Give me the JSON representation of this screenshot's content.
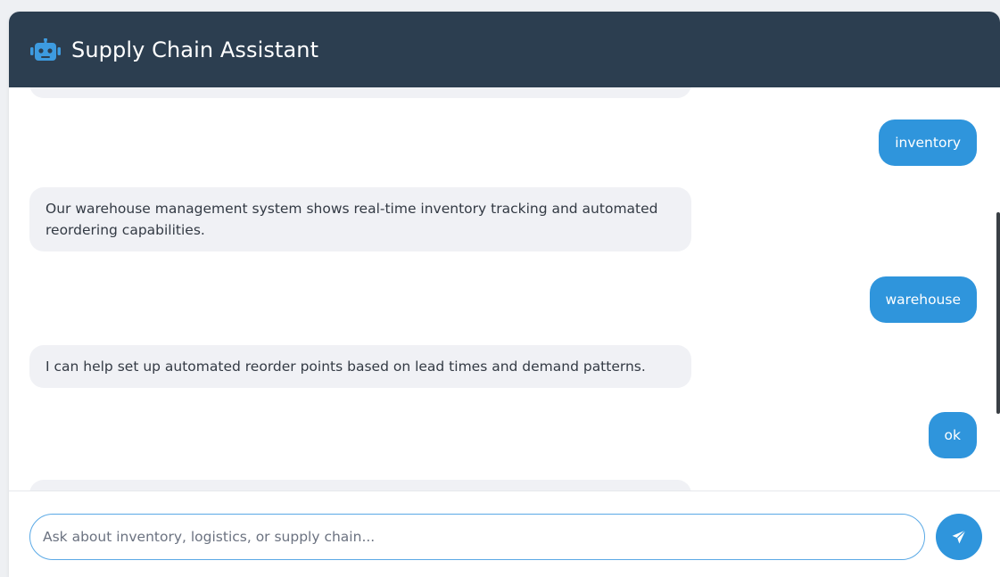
{
  "header": {
    "title": "Supply Chain Assistant",
    "icon": "robot-icon",
    "background": "#2c3e50"
  },
  "messages": [
    {
      "role": "bot",
      "text": ""
    },
    {
      "role": "user",
      "text": "inventory"
    },
    {
      "role": "bot",
      "text": "Our warehouse management system shows real-time inventory tracking and automated reordering capabilities."
    },
    {
      "role": "user",
      "text": "warehouse"
    },
    {
      "role": "bot",
      "text": "I can help set up automated reorder points based on lead times and demand patterns."
    },
    {
      "role": "user",
      "text": "ok"
    },
    {
      "role": "bot",
      "text": ""
    }
  ],
  "input": {
    "placeholder": "Ask about inventory, logistics, or supply chain...",
    "value": ""
  },
  "send": {
    "icon": "paper-plane-icon"
  },
  "colors": {
    "accent": "#2f95dc",
    "bot_bubble": "#f0f1f5"
  }
}
